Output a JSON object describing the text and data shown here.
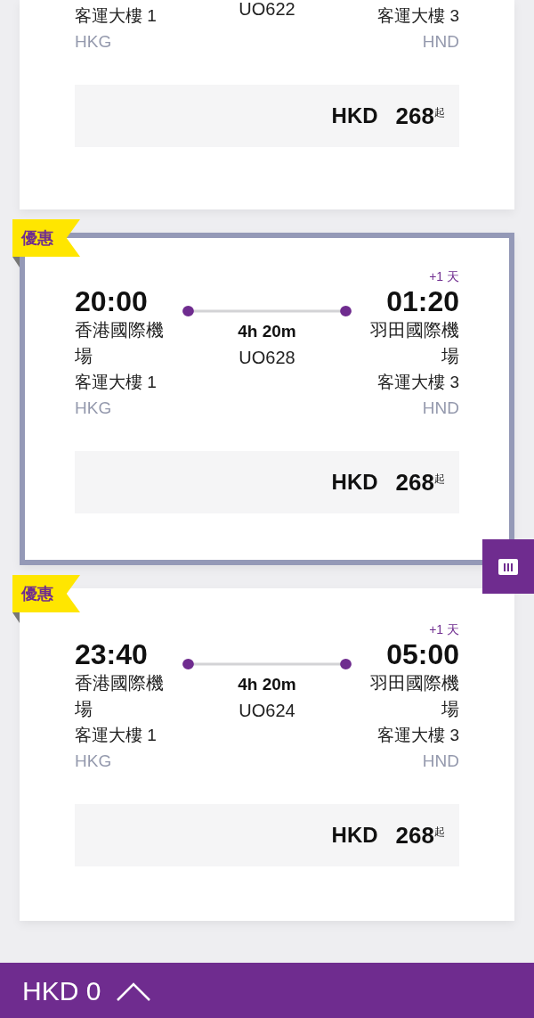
{
  "flights": [
    {
      "selected": false,
      "departure": {
        "terminal": "客運大樓 1",
        "code": "HKG"
      },
      "arrival": {
        "terminal": "客運大樓 3",
        "code": "HND"
      },
      "flight_number": "UO622",
      "price": {
        "currency": "HKD",
        "amount": "268",
        "suffix": "起"
      }
    },
    {
      "selected": true,
      "badge": "優惠",
      "departure": {
        "time": "20:00",
        "airport": "香港國際機場",
        "terminal": "客運大樓 1",
        "code": "HKG"
      },
      "arrival": {
        "day_offset": "+1 天",
        "time": "01:20",
        "airport": "羽田國際機場",
        "terminal": "客運大樓 3",
        "code": "HND"
      },
      "duration": "4h 20m",
      "flight_number": "UO628",
      "price": {
        "currency": "HKD",
        "amount": "268",
        "suffix": "起"
      }
    },
    {
      "selected": false,
      "badge": "優惠",
      "departure": {
        "time": "23:40",
        "airport": "香港國際機場",
        "terminal": "客運大樓 1",
        "code": "HKG"
      },
      "arrival": {
        "day_offset": "+1 天",
        "time": "05:00",
        "airport": "羽田國際機場",
        "terminal": "客運大樓 3",
        "code": "HND"
      },
      "duration": "4h 20m",
      "flight_number": "UO624",
      "price": {
        "currency": "HKD",
        "amount": "268",
        "suffix": "起"
      }
    }
  ],
  "bottom_bar": {
    "total": "HKD 0"
  }
}
